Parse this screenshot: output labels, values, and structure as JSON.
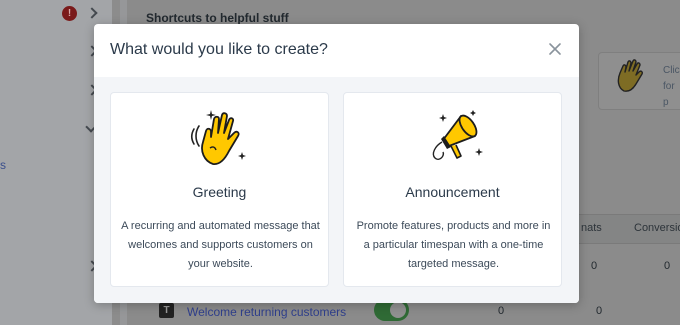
{
  "background": {
    "sidebar_badge": "!",
    "sidebar_link": "s",
    "section_heading": "Shortcuts to helpful stuff",
    "card_text_line1": "Clic",
    "card_text_line2": "for p",
    "table_headers": [
      "nats",
      "Conversio"
    ],
    "row_values": [
      "0",
      "0"
    ],
    "last_row": {
      "icon_letter": "T",
      "name": "Welcome returning customers",
      "value1": "0",
      "value2": "0"
    }
  },
  "modal": {
    "title": "What would you like to create?",
    "close_icon": "close-icon",
    "options": [
      {
        "title": "Greeting",
        "description": "A recurring and automated message that welcomes and supports customers on your website.",
        "icon": "waving-hand-icon"
      },
      {
        "title": "Announcement",
        "description": "Promote features, products and more in a particular timespan with a one-time targeted message.",
        "icon": "megaphone-icon"
      }
    ]
  },
  "colors": {
    "illustration_yellow": "#ffc800",
    "overlay": "#8b8b8b",
    "modal_body": "#f3f5f8",
    "toggle_on": "#2f6a35"
  }
}
